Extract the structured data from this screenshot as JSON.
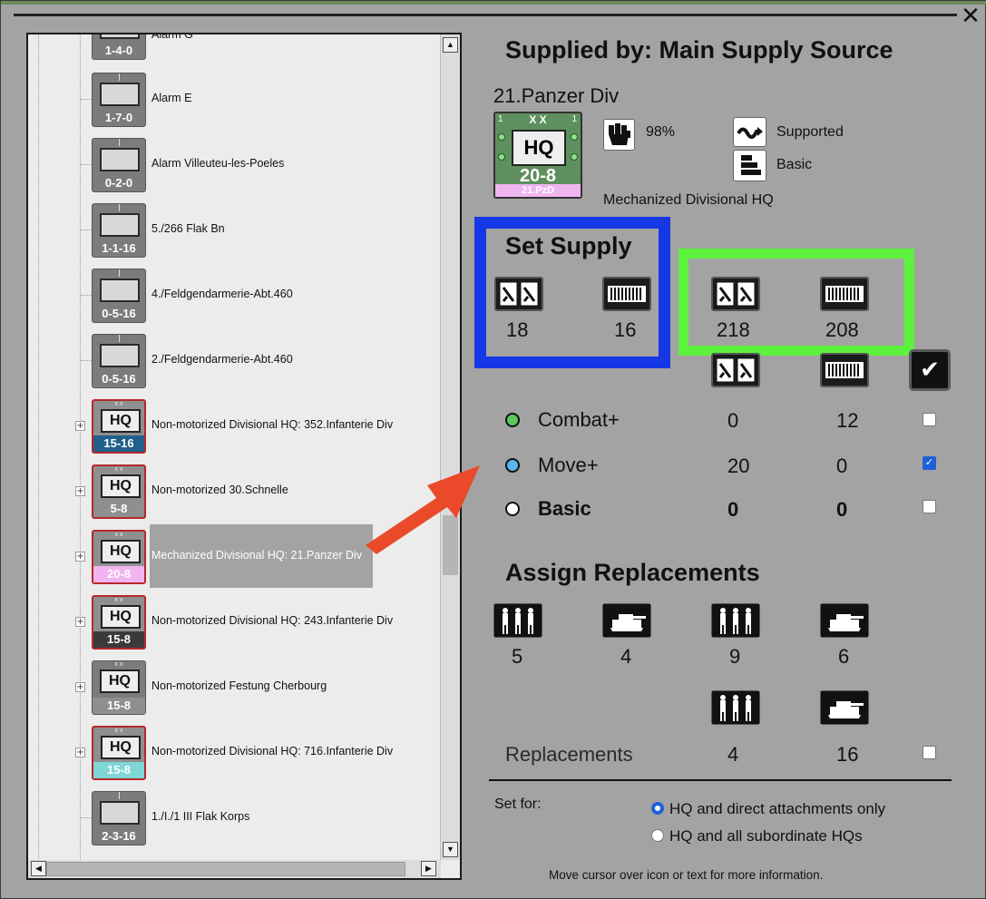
{
  "tree": {
    "partial_top": {
      "label": "Alarm G",
      "strength": "1-4-0"
    },
    "rows": [
      {
        "label": "Alarm E",
        "strength": "1-7-0",
        "kind": "motorcycle",
        "border": "gray"
      },
      {
        "label": "Alarm Villeuteu-les-Poeles",
        "strength": "0-2-0",
        "kind": "motorcycle",
        "border": "gray"
      },
      {
        "label": "5./266 Flak Bn",
        "strength": "1-1-16",
        "kind": "gun",
        "border": "gray"
      },
      {
        "label": "4./Feldgendarmerie-Abt.460",
        "strength": "0-5-16",
        "kind": "motorcycle",
        "border": "gray"
      },
      {
        "label": "2./Feldgendarmerie-Abt.460",
        "strength": "0-5-16",
        "kind": "motorcycle",
        "border": "gray"
      },
      {
        "label": "Non-motorized Divisional HQ: 352.Infanterie Div",
        "strength": "15-16",
        "kind": "hq",
        "border": "red",
        "strip": "#22608c"
      },
      {
        "label": "Non-motorized 30.Schnelle",
        "strength": "5-8",
        "kind": "hq",
        "border": "red",
        "strip": "#8f8f8f"
      },
      {
        "label": "Mechanized Divisional HQ: 21.Panzer Div",
        "strength": "20-8",
        "kind": "hq",
        "border": "red",
        "strip": "#f0b4f0",
        "selected": true
      },
      {
        "label": "Non-motorized Divisional HQ: 243.Infanterie Div",
        "strength": "15-8",
        "kind": "hq",
        "border": "red",
        "strip": "#3a3a3a"
      },
      {
        "label": "Non-motorized Festung Cherbourg",
        "strength": "15-8",
        "kind": "hq",
        "border": "gray",
        "strip": "#8f8f8f"
      },
      {
        "label": "Non-motorized Divisional HQ: 716.Infanterie Div",
        "strength": "15-8",
        "kind": "hq",
        "border": "red",
        "strip": "#7fd6d6"
      },
      {
        "label": "1./I./1 III Flak Korps",
        "strength": "2-3-16",
        "kind": "flak",
        "border": "gray"
      }
    ]
  },
  "panel": {
    "supplied_by": "Supplied by: Main Supply Source",
    "unit_name": "21.Panzer Div",
    "counter": {
      "size": "X X",
      "left": "1",
      "right": "1",
      "hq": "HQ",
      "strength": "20-8",
      "unit": "21.PzD"
    },
    "morale": "98%",
    "supported": "Supported",
    "basic": "Basic",
    "unit_type": "Mechanized Divisional HQ",
    "set_supply": "Set Supply",
    "supply_levels": {
      "ammo": "18",
      "fuel": "16"
    },
    "supply_levels_green": {
      "ammo": "218",
      "fuel": "208"
    },
    "options": [
      {
        "label": "Combat+",
        "ammo": "0",
        "fuel": "12",
        "dot": "#5cc85c",
        "checked": false
      },
      {
        "label": "Move+",
        "ammo": "20",
        "fuel": "0",
        "dot": "#58b7ef",
        "checked": true
      },
      {
        "label": "Basic",
        "ammo": "0",
        "fuel": "0",
        "dot": "#ffffff",
        "checked": false,
        "bold": true
      }
    ],
    "assign_replacements": "Assign Replacements",
    "replacement_values": [
      "5",
      "4",
      "9",
      "6"
    ],
    "replacements_label": "Replacements",
    "replacements_values": [
      "4",
      "16"
    ],
    "set_for": "Set for:",
    "set_for_options": [
      "HQ and direct attachments only",
      "HQ and all subordinate HQs"
    ],
    "hint": "Move cursor over icon or text for more information."
  },
  "colors": {
    "blue_box": "#1637e5",
    "green_box": "#5df23d",
    "arrow": "#ea4a2a"
  }
}
